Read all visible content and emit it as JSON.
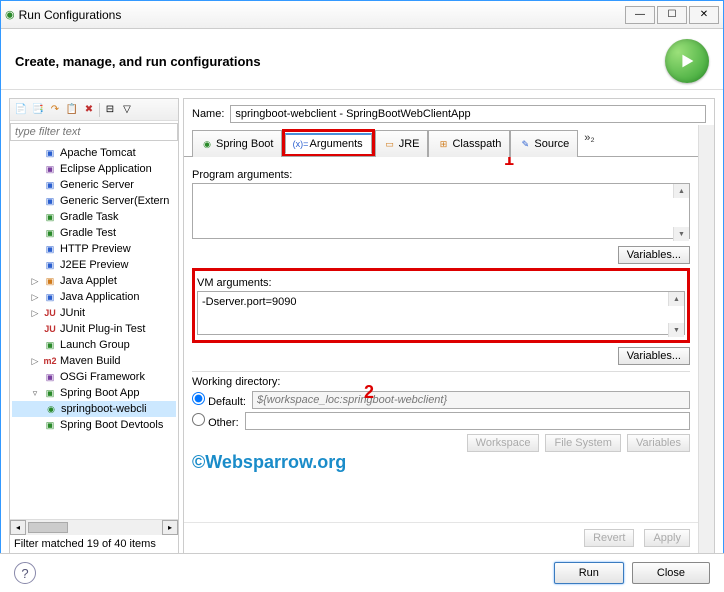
{
  "window": {
    "title": "Run Configurations"
  },
  "header": {
    "heading": "Create, manage, and run configurations"
  },
  "left": {
    "filter_placeholder": "type filter text",
    "items": [
      {
        "label": "Apache Tomcat",
        "icon": "server",
        "color": "i-blue"
      },
      {
        "label": "Eclipse Application",
        "icon": "eclipse",
        "color": "i-purple"
      },
      {
        "label": "Generic Server",
        "icon": "server",
        "color": "i-blue"
      },
      {
        "label": "Generic Server(Extern",
        "icon": "server",
        "color": "i-blue"
      },
      {
        "label": "Gradle Task",
        "icon": "gradle",
        "color": "i-green"
      },
      {
        "label": "Gradle Test",
        "icon": "gradle",
        "color": "i-green"
      },
      {
        "label": "HTTP Preview",
        "icon": "http",
        "color": "i-blue"
      },
      {
        "label": "J2EE Preview",
        "icon": "j2ee",
        "color": "i-blue"
      },
      {
        "label": "Java Applet",
        "icon": "java",
        "color": "i-orange",
        "exp": "▷"
      },
      {
        "label": "Java Application",
        "icon": "java",
        "color": "i-blue",
        "exp": "▷"
      },
      {
        "label": "JUnit",
        "icon": "junit",
        "color": "i-red",
        "prefix": "JU",
        "exp": "▷"
      },
      {
        "label": "JUnit Plug-in Test",
        "icon": "junit",
        "color": "i-red",
        "prefix": "JU"
      },
      {
        "label": "Launch Group",
        "icon": "group",
        "color": "i-green"
      },
      {
        "label": "Maven Build",
        "icon": "maven",
        "color": "i-red",
        "prefix": "m2",
        "exp": "▷"
      },
      {
        "label": "OSGi Framework",
        "icon": "osgi",
        "color": "i-purple"
      },
      {
        "label": "Spring Boot App",
        "icon": "spring",
        "color": "i-green",
        "exp": "▿",
        "children": [
          {
            "label": "springboot-webcli",
            "selected": true
          }
        ]
      },
      {
        "label": "Spring Boot Devtools",
        "icon": "spring",
        "color": "i-green"
      }
    ],
    "filter_status": "Filter matched 19 of 40 items"
  },
  "right": {
    "name_label": "Name:",
    "name_value": "springboot-webclient - SpringBootWebClientApp",
    "tabs": [
      {
        "label": "Spring Boot",
        "icon": "spring"
      },
      {
        "label": "Arguments",
        "icon": "args",
        "active": true
      },
      {
        "label": "JRE",
        "icon": "jre"
      },
      {
        "label": "Classpath",
        "icon": "cp"
      },
      {
        "label": "Source",
        "icon": "src"
      }
    ],
    "tabs_more": "»₂",
    "program_args_label": "Program arguments:",
    "program_args_value": "",
    "vm_args_label": "VM arguments:",
    "vm_args_value": "-Dserver.port=9090",
    "variables_label": "Variables...",
    "working_dir_label": "Working directory:",
    "wd_default_label": "Default:",
    "wd_default_value": "${workspace_loc:springboot-webclient}",
    "wd_other_label": "Other:",
    "wd_buttons": [
      "Workspace",
      "File System",
      "Variables"
    ],
    "callout1": "1",
    "callout2": "2"
  },
  "footer": {
    "revert": "Revert",
    "apply": "Apply",
    "run": "Run",
    "close": "Close"
  },
  "watermark": "©Websparrow.org"
}
